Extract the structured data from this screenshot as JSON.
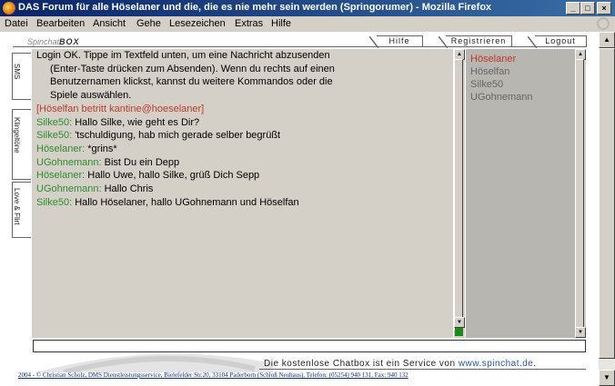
{
  "window": {
    "title": "DAS Forum für alle Höselaner und die, die es nie mehr sein werden (Springorumer) - Mozilla Firefox"
  },
  "menu": [
    "Datei",
    "Bearbeiten",
    "Ansicht",
    "Gehe",
    "Lesezeichen",
    "Extras",
    "Hilfe"
  ],
  "brand": {
    "prefix": "Spinchat",
    "name": "BOX"
  },
  "top_tabs": [
    "Hilfe",
    "Registrieren",
    "Logout"
  ],
  "side_tabs": [
    "SMS",
    "Klingeltöne",
    "Love & Flirt"
  ],
  "chat": {
    "intro": [
      "Login OK. Tippe im Textfeld unten, um eine Nachricht abzusenden",
      "(Enter-Taste drücken zum Absenden). Wenn du rechts auf einen",
      "Benutzernamen klickst, kannst du weitere Kommandos oder die",
      "Spiele auswählen."
    ],
    "info": "[Höselfan betritt kantine@hoeselaner]",
    "messages": [
      {
        "nick": "Silke50:",
        "text": " Hallo Silke, wie geht es Dir?"
      },
      {
        "nick": "Silke50:",
        "text": " 'tschuldigung, hab mich gerade selber begrüßt"
      },
      {
        "nick": "Höselaner:",
        "text": " *grins*"
      },
      {
        "nick": "UGohnemann:",
        "text": " Bist Du ein Depp"
      },
      {
        "nick": "Höselaner:",
        "text": " Hallo Uwe, hallo Silke, grüß Dich Sepp"
      },
      {
        "nick": "UGohnemann:",
        "text": " Hallo Chris"
      },
      {
        "nick": "Silke50:",
        "text": " Hallo Höselaner, hallo UGohnemann und Höselfan"
      }
    ]
  },
  "users": [
    "Höselaner",
    "Höselfan",
    "Silke50",
    "UGohnemann"
  ],
  "input": {
    "value": ""
  },
  "footer": {
    "text": "Die kostenlose Chatbox ist ein Service von ",
    "link": "www.spinchat.de",
    "end": "."
  },
  "credits": "2004 - © Christian Scholz, DMS Dienstleistungsservice, Bielefelder Str.20, 33104 Paderborn (Schloß Neuhaus), Telefon: (05254) 940 131, Fax: 940 132",
  "colors": {
    "titlebar": "#0a246a",
    "chat_bg": "#d4d0c8",
    "nick": "#2e8b2e",
    "info": "#c0392b",
    "userlist_bg": "#b8b6b0"
  }
}
